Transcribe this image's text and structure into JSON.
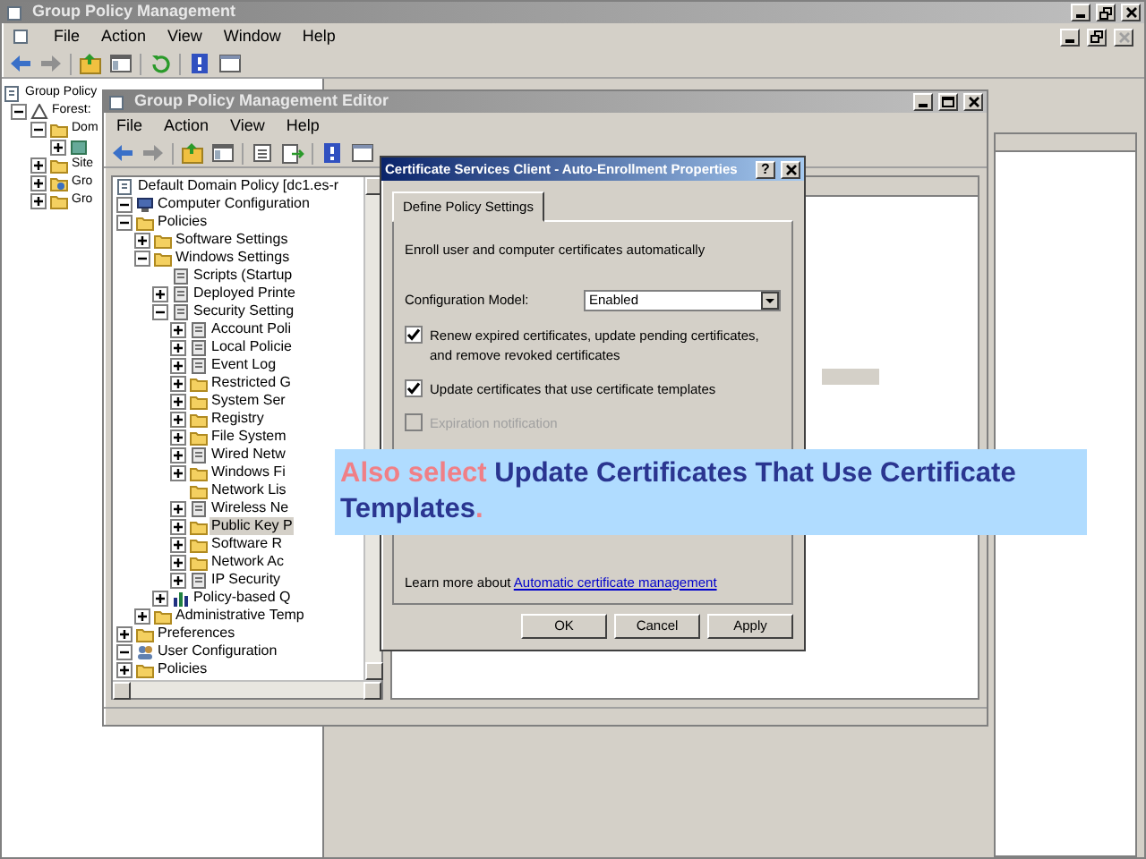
{
  "gpm_window": {
    "title": "Group Policy Management",
    "menu": [
      "File",
      "Action",
      "View",
      "Window",
      "Help"
    ],
    "tree": [
      {
        "label": "Group Policy",
        "kind": "root",
        "expandable": false,
        "selected": false,
        "children": [
          {
            "label": "Forest:",
            "kind": "forest",
            "expandable": true,
            "expanded": true,
            "selected": false,
            "children": [
              {
                "label": "Dom",
                "kind": "folder",
                "expandable": true,
                "expanded": true,
                "selected": false,
                "children": [
                  {
                    "kind": "domain",
                    "expandable": true,
                    "expanded": false
                  }
                ]
              },
              {
                "label": "Site",
                "kind": "folder",
                "expandable": true,
                "expanded": false,
                "selected": false
              },
              {
                "label": "Gro",
                "kind": "policy",
                "expandable": true,
                "expanded": false,
                "selected": false
              },
              {
                "label": "Gro",
                "kind": "folder",
                "expandable": true,
                "expanded": false,
                "selected": false
              }
            ]
          }
        ]
      }
    ]
  },
  "editor_window": {
    "title": "Group Policy Management Editor",
    "menu": [
      "File",
      "Action",
      "View",
      "Help"
    ],
    "tree": [
      {
        "label": "Default Domain Policy [dc1.es-r",
        "kind": "root",
        "expandable": false,
        "selected": false
      },
      {
        "label": "Computer Configuration",
        "kind": "computer",
        "expandable": true,
        "expanded": true,
        "selected": false,
        "children": [
          {
            "label": "Policies",
            "kind": "folder",
            "expandable": true,
            "expanded": true,
            "selected": false,
            "children": [
              {
                "label": "Software Settings",
                "kind": "folder",
                "expandable": true,
                "expanded": false,
                "selected": false
              },
              {
                "label": "Windows Settings",
                "kind": "folder",
                "expandable": true,
                "expanded": true,
                "selected": false,
                "children": [
                  {
                    "label": "Scripts (Startup",
                    "kind": "setting",
                    "expandable": false,
                    "selected": false
                  },
                  {
                    "label": "Deployed Printe",
                    "kind": "setting",
                    "expandable": true,
                    "expanded": false,
                    "selected": false
                  },
                  {
                    "label": "Security Setting",
                    "kind": "setting",
                    "expandable": true,
                    "expanded": true,
                    "selected": false,
                    "children": [
                      {
                        "label": "Account Poli",
                        "kind": "setting",
                        "expandable": true,
                        "expanded": false,
                        "selected": false
                      },
                      {
                        "label": "Local Policie",
                        "kind": "setting",
                        "expandable": true,
                        "expanded": false,
                        "selected": false
                      },
                      {
                        "label": "Event Log",
                        "kind": "setting",
                        "expandable": true,
                        "expanded": false,
                        "selected": false
                      },
                      {
                        "label": "Restricted G",
                        "kind": "folder",
                        "expandable": true,
                        "expanded": false,
                        "selected": false
                      },
                      {
                        "label": "System Ser",
                        "kind": "folder",
                        "expandable": true,
                        "expanded": false,
                        "selected": false
                      },
                      {
                        "label": "Registry",
                        "kind": "folder",
                        "expandable": true,
                        "expanded": false,
                        "selected": false
                      },
                      {
                        "label": "File System",
                        "kind": "folder",
                        "expandable": true,
                        "expanded": false,
                        "selected": false
                      },
                      {
                        "label": "Wired Netw",
                        "kind": "setting",
                        "expandable": true,
                        "expanded": false,
                        "selected": false
                      },
                      {
                        "label": "Windows Fi",
                        "kind": "folder",
                        "expandable": true,
                        "expanded": false,
                        "selected": false
                      },
                      {
                        "label": "Network Lis",
                        "kind": "folder",
                        "expandable": false,
                        "selected": false
                      },
                      {
                        "label": "Wireless Ne",
                        "kind": "setting",
                        "expandable": true,
                        "expanded": false,
                        "selected": false
                      },
                      {
                        "label": "Public Key P",
                        "kind": "folder",
                        "expandable": true,
                        "expanded": false,
                        "selected": true
                      },
                      {
                        "label": "Software R",
                        "kind": "folder",
                        "expandable": true,
                        "expanded": false,
                        "selected": false
                      },
                      {
                        "label": "Network Ac",
                        "kind": "folder",
                        "expandable": true,
                        "expanded": false,
                        "selected": false
                      },
                      {
                        "label": "IP Security",
                        "kind": "setting",
                        "expandable": true,
                        "expanded": false,
                        "selected": false
                      }
                    ]
                  },
                  {
                    "label": "Policy-based Q",
                    "kind": "chart",
                    "expandable": true,
                    "expanded": false,
                    "selected": false
                  }
                ]
              },
              {
                "label": "Administrative Temp",
                "kind": "folder",
                "expandable": true,
                "expanded": false,
                "selected": false
              }
            ]
          },
          {
            "label": "Preferences",
            "kind": "folder",
            "expandable": true,
            "expanded": false,
            "selected": false
          }
        ]
      },
      {
        "label": "User Configuration",
        "kind": "user",
        "expandable": true,
        "expanded": true,
        "selected": false,
        "children": [
          {
            "label": "Policies",
            "kind": "folder",
            "expandable": true,
            "expanded": false,
            "selected": false
          }
        ]
      }
    ]
  },
  "dialog": {
    "title": "Certificate Services Client - Auto-Enrollment Properties",
    "help_button": "?",
    "tabs": [
      {
        "label": "Define Policy Settings",
        "selected": true
      }
    ],
    "description": "Enroll user and computer certificates automatically",
    "config_label": "Configuration Model:",
    "config_value": "Enabled",
    "options": [
      {
        "label": "Renew expired certificates, update pending certificates, and remove revoked certificates",
        "checked": true,
        "disabled": false
      },
      {
        "label": "Update certificates that use certificate templates",
        "checked": true,
        "disabled": false
      },
      {
        "label": "Expiration notification",
        "checked": false,
        "disabled": true
      }
    ],
    "learn_more": "Learn more about",
    "learn_more_link": "Automatic certificate management",
    "buttons": [
      "OK",
      "Cancel",
      "Apply"
    ]
  },
  "callout": {
    "parts": [
      {
        "text": "Also select",
        "highlight": true
      },
      {
        "text": "Update Certificates That Use Certificate Templates",
        "highlight": false
      },
      {
        "text": ".",
        "highlight": true
      }
    ]
  }
}
